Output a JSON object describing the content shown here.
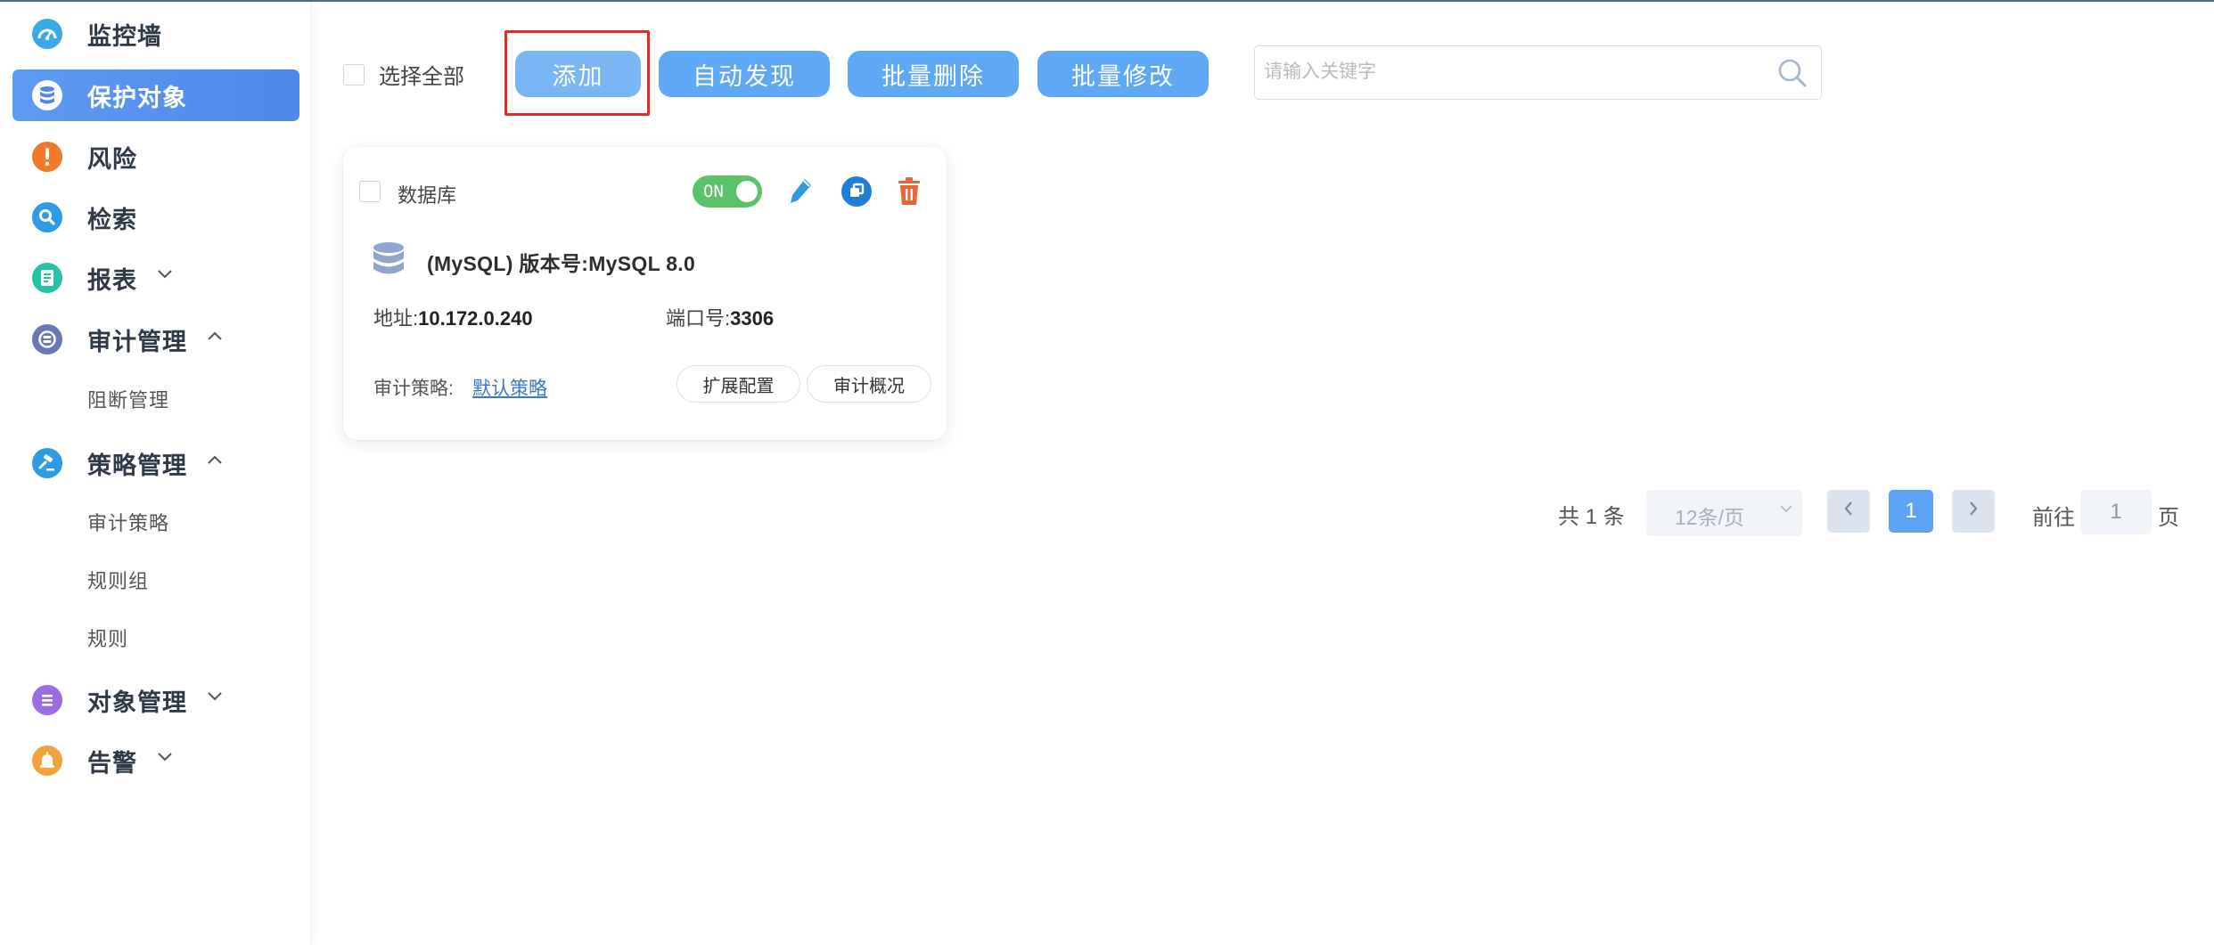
{
  "sidebar": {
    "items": [
      {
        "label": "监控墙",
        "icon": "dashboard-icon",
        "color": "#3aa9e8"
      },
      {
        "label": "保护对象",
        "icon": "database-icon",
        "color": "#ffffff",
        "active": true
      },
      {
        "label": "风险",
        "icon": "exclamation-icon",
        "color": "#f07a2a"
      },
      {
        "label": "检索",
        "icon": "search-icon",
        "color": "#2f9be6"
      },
      {
        "label": "报表",
        "icon": "report-icon",
        "color": "#27c1a4"
      },
      {
        "label": "审计管理",
        "icon": "audit-icon",
        "color": "#6a77b3"
      },
      {
        "label": "策略管理",
        "icon": "gavel-icon",
        "color": "#2f9be6"
      },
      {
        "label": "对象管理",
        "icon": "list-icon",
        "color": "#9a6ee0"
      },
      {
        "label": "告警",
        "icon": "alarm-icon",
        "color": "#f2a23a"
      }
    ],
    "sub_audit": [
      "阻断管理"
    ],
    "sub_policy": [
      "审计策略",
      "规则组",
      "规则"
    ]
  },
  "toolbar": {
    "select_all": "选择全部",
    "add": "添加",
    "auto_discover": "自动发现",
    "batch_delete": "批量删除",
    "batch_edit": "批量修改",
    "search_placeholder": "请输入关键字"
  },
  "card": {
    "type": "数据库",
    "toggle": "ON",
    "db_title": "(MySQL)   版本号:MySQL 8.0",
    "address_label": "地址:",
    "address": "10.172.0.240",
    "port_label": "端口号:",
    "port": "3306",
    "policy_label": "审计策略:",
    "policy_link": "默认策略",
    "ext_config": "扩展配置",
    "audit_overview": "审计概况",
    "colors": {
      "toggle_on": "#5cc16b",
      "edit": "#2f9be6",
      "copy": "#1f7fd6",
      "delete": "#e8653a"
    }
  },
  "pagination": {
    "total": "共 1 条",
    "page_size": "12条/页",
    "current": "1",
    "goto_label": "前往",
    "goto_value": "1",
    "page_suffix": "页"
  }
}
